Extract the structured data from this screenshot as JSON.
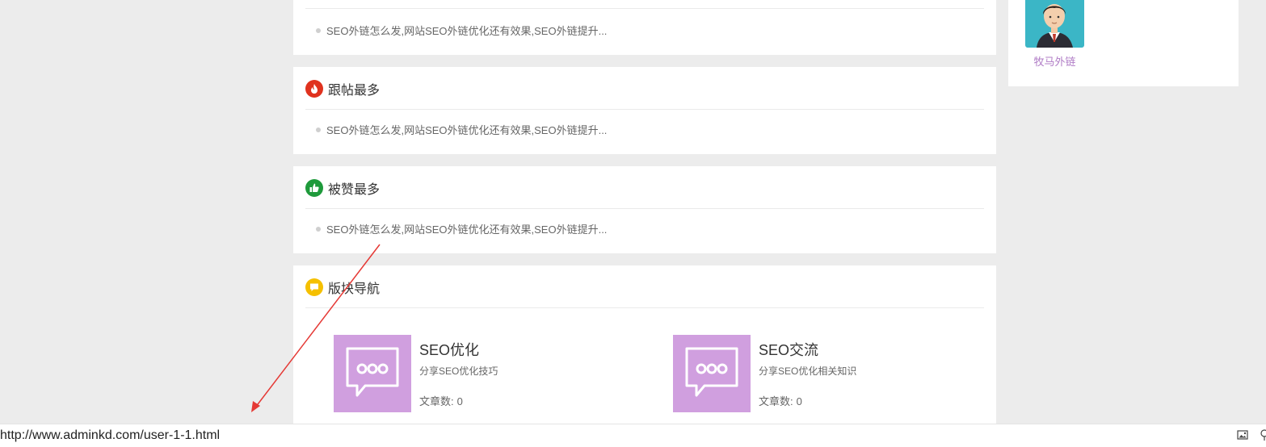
{
  "top_card": {
    "item": "SEO外链怎么发,网站SEO外链优化还有效果,SEO外链提升..."
  },
  "most_replies": {
    "title": "跟帖最多",
    "icon": "fire-icon",
    "color": "#e0321e",
    "item": "SEO外链怎么发,网站SEO外链优化还有效果,SEO外链提升..."
  },
  "most_liked": {
    "title": "被赞最多",
    "icon": "thumbs-up-icon",
    "color": "#1e9a3b",
    "item": "SEO外链怎么发,网站SEO外链优化还有效果,SEO外链提升..."
  },
  "board_nav": {
    "title": "版块导航",
    "icon": "comment-icon",
    "color": "#f5c000",
    "forums": [
      {
        "name": "SEO优化",
        "desc": "分享SEO优化技巧",
        "count_label": "文章数:",
        "count": "0"
      },
      {
        "name": "SEO交流",
        "desc": "分享SEO优化相关知识",
        "count_label": "文章数:",
        "count": "0"
      }
    ],
    "forum_icon_color": "#d09fdf"
  },
  "sidebar": {
    "user_name": "牧马外链",
    "avatar_color": "#3bb6c6",
    "name_color": "#b07cc6"
  },
  "statusbar": {
    "url": "http://www.adminkd.com/user-1-1.html"
  },
  "annotation": {
    "color": "#e53935"
  }
}
